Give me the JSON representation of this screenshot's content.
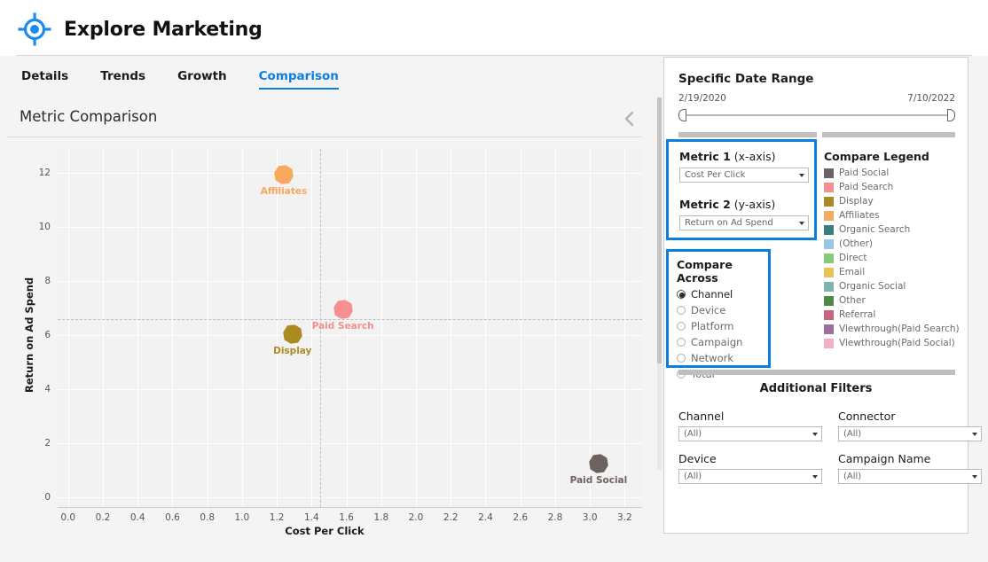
{
  "header": {
    "title": "Explore Marketing",
    "logo_icon": "crosshair-target-icon",
    "accent_color": "#0b7fe0"
  },
  "tabs": [
    {
      "label": "Details",
      "active": false
    },
    {
      "label": "Trends",
      "active": false
    },
    {
      "label": "Growth",
      "active": false
    },
    {
      "label": "Comparison",
      "active": true
    }
  ],
  "chart_panel": {
    "title": "Metric Comparison",
    "collapse_icon": "chevron-left-icon"
  },
  "chart_data": {
    "type": "scatter",
    "title": "Metric Comparison",
    "xlabel": "Cost Per Click",
    "ylabel": "Return on Ad Spend",
    "xlim": [
      -0.06,
      3.3
    ],
    "ylim": [
      -0.35,
      12.9
    ],
    "xticks": [
      "0.0",
      "0.2",
      "0.4",
      "0.6",
      "0.8",
      "1.0",
      "1.2",
      "1.4",
      "1.6",
      "1.8",
      "2.0",
      "2.2",
      "2.4",
      "2.6",
      "2.8",
      "3.0",
      "3.2"
    ],
    "xtick_values": [
      0.0,
      0.2,
      0.4,
      0.6,
      0.8,
      1.0,
      1.2,
      1.4,
      1.6,
      1.8,
      2.0,
      2.2,
      2.4,
      2.6,
      2.8,
      3.0,
      3.2
    ],
    "yticks": [
      "0",
      "2",
      "4",
      "6",
      "8",
      "10",
      "12"
    ],
    "ytick_values": [
      0,
      2,
      4,
      6,
      8,
      10,
      12
    ],
    "grid": true,
    "plot_bg": "#f2f2f2",
    "gridline_color": "#ffffff",
    "reference_lines": {
      "x": 1.45,
      "y": 6.6,
      "style": "dashed",
      "color": "#c0bfbf"
    },
    "points": [
      {
        "label": "Affiliates",
        "x": 1.24,
        "y": 11.95,
        "color": "#f8a95e"
      },
      {
        "label": "Paid Search",
        "x": 1.58,
        "y": 6.95,
        "color": "#f68f8f"
      },
      {
        "label": "Display",
        "x": 1.29,
        "y": 6.05,
        "color": "#ab8b21"
      },
      {
        "label": "Paid Social",
        "x": 3.05,
        "y": 1.25,
        "color": "#6d6260"
      }
    ]
  },
  "date_range": {
    "title": "Specific Date Range",
    "start": "2/19/2020",
    "end": "7/10/2022"
  },
  "metrics": {
    "metric1_label_bold": "Metric 1",
    "metric1_label_rest": " (x-axis)",
    "metric1_value": "Cost Per Click",
    "metric2_label_bold": "Metric 2",
    "metric2_label_rest": " (y-axis)",
    "metric2_value": "Return on Ad Spend"
  },
  "compare_across": {
    "title": "Compare Across",
    "selected": "Channel",
    "options": [
      "Channel",
      "Device",
      "Platform",
      "Campaign",
      "Network",
      "Total"
    ]
  },
  "legend": {
    "title": "Compare Legend",
    "items": [
      {
        "label": "Paid Social",
        "color": "#6d6260"
      },
      {
        "label": "Paid Search",
        "color": "#f68f8f"
      },
      {
        "label": "Display",
        "color": "#ab8b21"
      },
      {
        "label": "Affiliates",
        "color": "#f8a95e"
      },
      {
        "label": "Organic Search",
        "color": "#3b7e80"
      },
      {
        "label": "(Other)",
        "color": "#9ac6e3"
      },
      {
        "label": "Direct",
        "color": "#84cc79"
      },
      {
        "label": "Email",
        "color": "#e9c25a"
      },
      {
        "label": "Organic Social",
        "color": "#7fb3ae"
      },
      {
        "label": "Other",
        "color": "#4d8b46"
      },
      {
        "label": "Referral",
        "color": "#c8647f"
      },
      {
        "label": "Viewthrough(Paid Search)",
        "color": "#a06e9b"
      },
      {
        "label": "Viewthrough(Paid Social)",
        "color": "#f3aec9"
      }
    ]
  },
  "additional_filters": {
    "title": "Additional Filters",
    "fields": [
      {
        "label": "Channel",
        "value": "(All)"
      },
      {
        "label": "Connector",
        "value": "(All)"
      },
      {
        "label": "Device",
        "value": "(All)"
      },
      {
        "label": "Campaign Name",
        "value": "(All)"
      }
    ]
  }
}
